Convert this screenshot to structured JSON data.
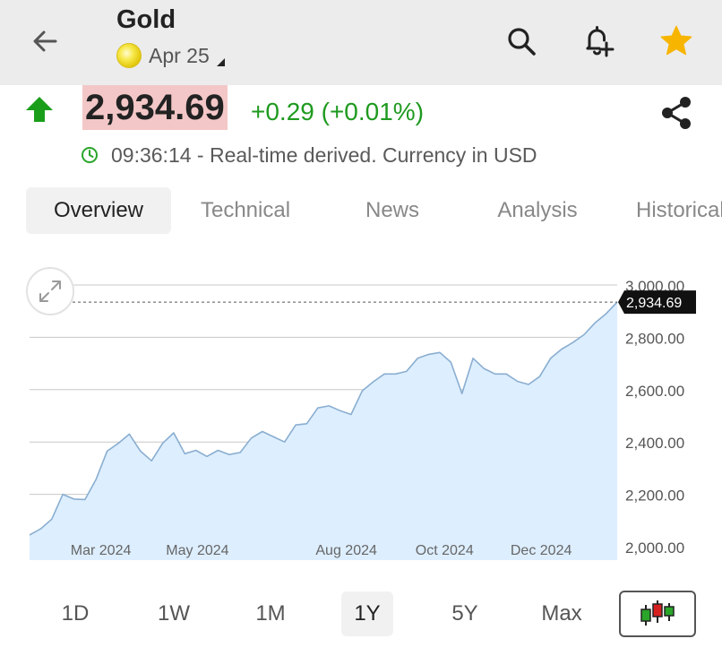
{
  "header": {
    "title": "Gold",
    "contract": "Apr 25",
    "icons": {
      "back": "arrow-left-icon",
      "search": "search-icon",
      "alert": "add-alert-bell-icon",
      "favorite": "star-icon",
      "coin": "gold-coin-icon"
    },
    "colors": {
      "favorite": "#f7b500",
      "bar_bg": "#ececec"
    }
  },
  "quote": {
    "price": "2,934.69",
    "change": "+0.29 (+0.01%)",
    "direction": "up",
    "status": "09:36:14 - Real-time derived. Currency in USD",
    "colors": {
      "up": "#1f9a1f",
      "price_highlight": "#f3c7c7"
    }
  },
  "tabs": [
    {
      "label": "Overview",
      "active": true
    },
    {
      "label": "Technical",
      "active": false
    },
    {
      "label": "News",
      "active": false
    },
    {
      "label": "Analysis",
      "active": false
    },
    {
      "label": "Historical",
      "active": false
    }
  ],
  "ranges": [
    {
      "label": "1D",
      "active": false
    },
    {
      "label": "1W",
      "active": false
    },
    {
      "label": "1M",
      "active": false
    },
    {
      "label": "1Y",
      "active": true
    },
    {
      "label": "5Y",
      "active": false
    },
    {
      "label": "Max",
      "active": false
    }
  ],
  "chart_data": {
    "type": "area",
    "title": "",
    "xlabel": "",
    "ylabel": "",
    "ylim": [
      2000,
      3000
    ],
    "y_ticks": [
      "3,000.00",
      "2,800.00",
      "2,600.00",
      "2,400.00",
      "2,200.00",
      "2,000.00"
    ],
    "y_tick_values": [
      3000,
      2800,
      2600,
      2400,
      2200,
      2000
    ],
    "x_ticks": [
      "Mar 2024",
      "May 2024",
      "Aug 2024",
      "Oct 2024",
      "Dec 2024"
    ],
    "x_tick_values": [
      "2024-03-11",
      "2024-05-11",
      "2024-08-13",
      "2024-10-14",
      "2024-12-14"
    ],
    "last_price_label": "2,934.69",
    "last_price": 2934.69,
    "grid": true,
    "colors": {
      "line": "#8aaed0",
      "fill": "#ddeeff",
      "grid": "#c8c8c8",
      "price_tag": "#111111"
    },
    "series": [
      {
        "dates": [
          "2024-01-26",
          "2024-02-02",
          "2024-02-09",
          "2024-02-16",
          "2024-02-23",
          "2024-03-01",
          "2024-03-08",
          "2024-03-15",
          "2024-03-22",
          "2024-03-29",
          "2024-04-05",
          "2024-04-12",
          "2024-04-19",
          "2024-04-26",
          "2024-05-03",
          "2024-05-10",
          "2024-05-17",
          "2024-05-24",
          "2024-05-31",
          "2024-06-07",
          "2024-06-14",
          "2024-06-21",
          "2024-06-28",
          "2024-07-05",
          "2024-07-12",
          "2024-07-19",
          "2024-07-26",
          "2024-08-02",
          "2024-08-09",
          "2024-08-16",
          "2024-08-23",
          "2024-08-30",
          "2024-09-06",
          "2024-09-13",
          "2024-09-20",
          "2024-09-27",
          "2024-10-04",
          "2024-10-11",
          "2024-10-18",
          "2024-10-25",
          "2024-11-01",
          "2024-11-08",
          "2024-11-15",
          "2024-11-22",
          "2024-11-29",
          "2024-12-06",
          "2024-12-13",
          "2024-12-20",
          "2024-12-27",
          "2025-01-03",
          "2025-01-10",
          "2025-01-17",
          "2025-01-24",
          "2025-01-31"
        ],
        "values": [
          2045,
          2068,
          2105,
          2200,
          2182,
          2180,
          2258,
          2365,
          2395,
          2430,
          2365,
          2328,
          2395,
          2435,
          2355,
          2368,
          2345,
          2368,
          2352,
          2360,
          2415,
          2440,
          2420,
          2400,
          2465,
          2470,
          2530,
          2538,
          2520,
          2505,
          2595,
          2630,
          2660,
          2660,
          2670,
          2720,
          2735,
          2742,
          2705,
          2585,
          2720,
          2680,
          2660,
          2660,
          2632,
          2620,
          2650,
          2720,
          2755,
          2780,
          2810,
          2855,
          2890,
          2934.69
        ]
      }
    ]
  }
}
